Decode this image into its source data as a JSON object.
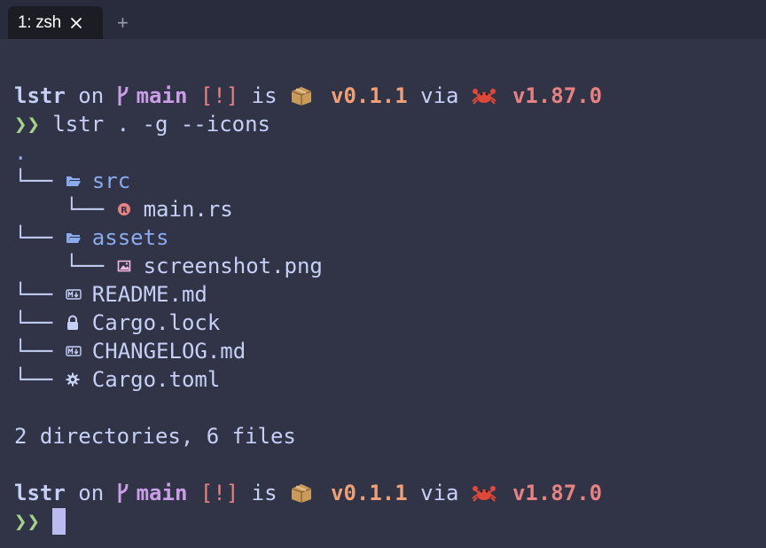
{
  "tab": {
    "title": "1: zsh",
    "close_icon": "close-icon",
    "new_tab": "+"
  },
  "prompt": {
    "dir": "lstr",
    "on": " on ",
    "branch_icon": "git-branch-icon",
    "branch": "main",
    "status": "[!]",
    "is": " is ",
    "package_icon": "package-icon",
    "pkg_version": "v0.1.1",
    "via": " via ",
    "rust_icon": "crab-icon",
    "rust_version": "v1.87.0",
    "chevrons": "❯❯"
  },
  "command": "lstr . -g --icons",
  "tree": {
    "root": ".",
    "items": [
      {
        "branch": "└── ",
        "icon": "folder-icon",
        "name": "src"
      },
      {
        "branch": "    └── ",
        "icon": "rust-file-icon",
        "name": "main.rs"
      },
      {
        "branch": "└── ",
        "icon": "folder-icon",
        "name": "assets"
      },
      {
        "branch": "    └── ",
        "icon": "image-file-icon",
        "name": "screenshot.png"
      },
      {
        "branch": "└── ",
        "icon": "markdown-file-icon",
        "name": "README.md"
      },
      {
        "branch": "└── ",
        "icon": "lock-file-icon",
        "name": "Cargo.lock"
      },
      {
        "branch": "└── ",
        "icon": "markdown-file-icon",
        "name": "CHANGELOG.md"
      },
      {
        "branch": "└── ",
        "icon": "gear-file-icon",
        "name": "Cargo.toml"
      }
    ],
    "summary": "2 directories, 6 files"
  },
  "colors": {
    "background": "#303446",
    "directory": "#8caaee",
    "branch": "#ca9ee6",
    "version": "#ef9f76",
    "prompt": "#a6d189"
  }
}
